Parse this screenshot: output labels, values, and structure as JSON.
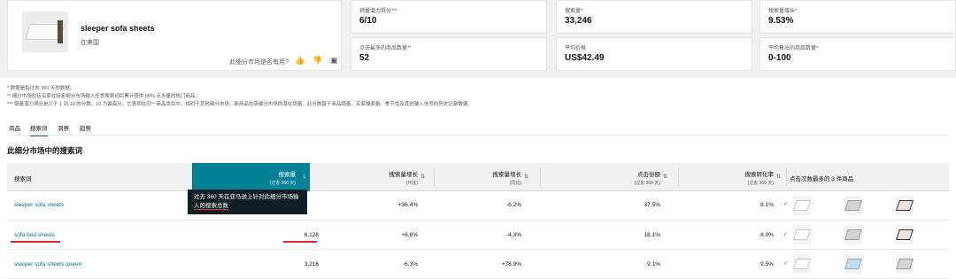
{
  "product": {
    "name": "sleeper sofa sheets",
    "subtitle": "在美国",
    "helpful_prompt": "此细分市场是否有用?",
    "icons": [
      "thumbs-up-icon",
      "thumbs-down-icon",
      "comment-icon"
    ]
  },
  "metrics": [
    {
      "label": "销量潜力得分***",
      "value": "6/10"
    },
    {
      "label": "搜索量*",
      "value": "33,246"
    },
    {
      "label": "搜索量增长*",
      "value": "9.53%"
    },
    {
      "label": "点击最多的商品数量**",
      "value": "52"
    },
    {
      "label": "平均价格",
      "value": "US$42.49"
    },
    {
      "label": "平均售出的商品数量*",
      "value": "0-100"
    }
  ],
  "footnotes": [
    "* 数据是指过去 360 天的数据。",
    "** 细分市场包括买家在特定细分市场输入任意搜索词后累计获得 80% 点击量的热门商品。",
    "*** 销量潜力得分是介于 1 到 10 的分数，10 为最高分。它表明在同一商品类目中，相对于其他细分市场，新商品在该细分市场的潜在销量。此分数基于商品销量、买家搜索量、季节性及其他输入信号的历史记录数据。"
  ],
  "tabs": [
    "商品",
    "搜索词",
    "洞察",
    "趋势"
  ],
  "active_tab": "搜索词",
  "section_title": "此细分市场中的搜索词",
  "table": {
    "headers": {
      "term": "搜索词",
      "volume": "搜索量",
      "volume_sub": "(过去 360 天)",
      "growth": "搜索量增长",
      "growth_sub": "(环比)",
      "growth_yoy": "搜索量增长",
      "growth_yoy_sub": "(同比)",
      "click_share": "点击份额",
      "click_share_sub": "(过去 360 天)",
      "conversion": "搜索转化率",
      "conversion_sub": "(过去 360 天)",
      "top_clicked": "点击次数最多的 3 件商品"
    },
    "tooltip_line1": "过去 360 天在亚马逊上针对此细分市场输",
    "tooltip_line2": "入的搜索总数",
    "rows": [
      {
        "term": "sleeper sofa sheets",
        "volume": "",
        "growth": "+36.4%",
        "growth_yoy": "-6.2%",
        "click_share": "37.5%",
        "conversion": "8.1%"
      },
      {
        "term": "sofa bed sheets",
        "volume": "6,128",
        "growth": "+8.6%",
        "growth_yoy": "-4.3%",
        "click_share": "18.1%",
        "conversion": "8.0%"
      },
      {
        "term": "sleeper sofa sheets queen",
        "volume": "3,216",
        "growth": "-6.3%",
        "growth_yoy": "+78.9%",
        "click_share": "9.1%",
        "conversion": "9.5%"
      }
    ]
  },
  "colors": {
    "accent": "#008296",
    "link": "#007185",
    "highlight": "#d32f2f"
  }
}
